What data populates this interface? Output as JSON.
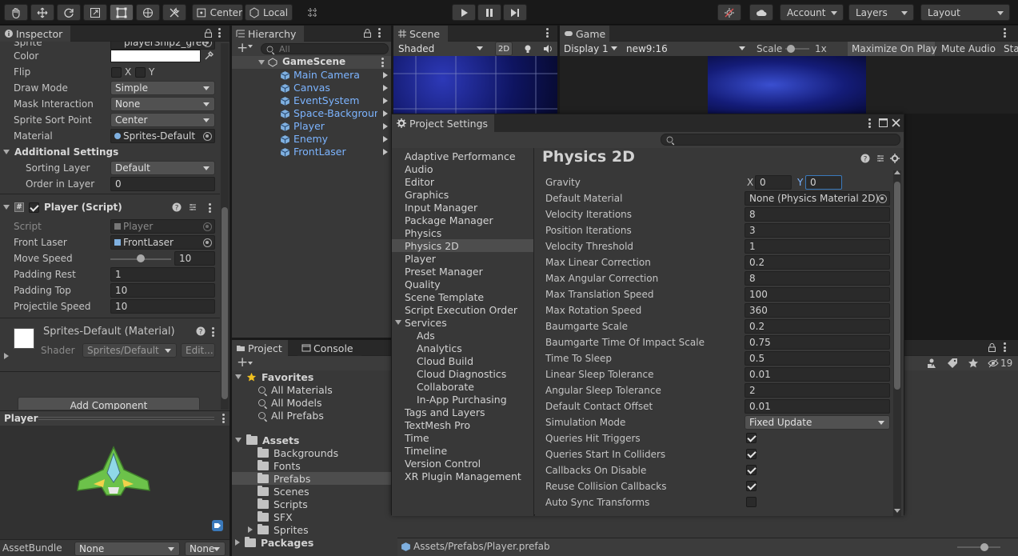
{
  "toolbar": {
    "pivot_label": "Center",
    "space_label": "Local",
    "account_label": "Account",
    "layers_label": "Layers",
    "layout_label": "Layout"
  },
  "inspector": {
    "tab_label": "Inspector",
    "sprite_label": "Sprite",
    "sprite_value": "playerShip2_gree",
    "color_label": "Color",
    "flip_label": "Flip",
    "flip_x": "X",
    "flip_y": "Y",
    "draw_mode_label": "Draw Mode",
    "draw_mode_value": "Simple",
    "mask_label": "Mask Interaction",
    "mask_value": "None",
    "sort_point_label": "Sprite Sort Point",
    "sort_point_value": "Center",
    "material_label": "Material",
    "material_value": "Sprites-Default",
    "additional_settings": "Additional Settings",
    "sorting_layer_label": "Sorting Layer",
    "sorting_layer_value": "Default",
    "order_label": "Order in Layer",
    "order_value": "0",
    "script_component": "Player (Script)",
    "script_label": "Script",
    "script_value": "Player",
    "front_laser_label": "Front Laser",
    "front_laser_value": "FrontLaser",
    "move_speed_label": "Move Speed",
    "move_speed_value": "10",
    "padding_rest_label": "Padding Rest",
    "padding_rest_value": "1",
    "padding_top_label": "Padding Top",
    "padding_top_value": "10",
    "projectile_speed_label": "Projectile Speed",
    "projectile_speed_value": "10",
    "material_header": "Sprites-Default (Material)",
    "shader_label": "Shader",
    "shader_value": "Sprites/Default",
    "edit_label": "Edit...",
    "add_component": "Add Component",
    "preview_title": "Player",
    "assetbundle_label": "AssetBundle",
    "assetbundle_value": "None",
    "assetbundle_variant": "None"
  },
  "hierarchy": {
    "tab_label": "Hierarchy",
    "search_placeholder": "All",
    "scene_name": "GameScene",
    "items": [
      "Main Camera",
      "Canvas",
      "EventSystem",
      "Space-Background",
      "Player",
      "Enemy",
      "FrontLaser"
    ]
  },
  "scene": {
    "tab_label": "Scene",
    "shading": "Shaded",
    "mode_2d": "2D"
  },
  "game": {
    "tab_label": "Game",
    "display": "Display 1",
    "aspect": "new9:16",
    "scale_label": "Scale",
    "scale_value": "1x",
    "maximize": "Maximize On Play",
    "mute": "Mute Audio",
    "stats": "Stats"
  },
  "project": {
    "tab_project": "Project",
    "tab_console": "Console",
    "favorites_label": "Favorites",
    "favorites": [
      "All Materials",
      "All Models",
      "All Prefabs"
    ],
    "assets_label": "Assets",
    "folders": [
      "Backgrounds",
      "Fonts",
      "Prefabs",
      "Scenes",
      "Scripts",
      "SFX",
      "Sprites"
    ],
    "packages_label": "Packages",
    "path": "Assets/Prefabs/Player.prefab",
    "hidden_count": "19"
  },
  "settings": {
    "window_title": "Project Settings",
    "categories": [
      "Adaptive Performance",
      "Audio",
      "Editor",
      "Graphics",
      "Input Manager",
      "Package Manager",
      "Physics",
      "Physics 2D",
      "Player",
      "Preset Manager",
      "Quality",
      "Scene Template",
      "Script Execution Order",
      "Services",
      "Ads",
      "Analytics",
      "Cloud Build",
      "Cloud Diagnostics",
      "Collaborate",
      "In-App Purchasing",
      "Tags and Layers",
      "TextMesh Pro",
      "Time",
      "Timeline",
      "Version Control",
      "XR Plugin Management"
    ],
    "selected": "Physics 2D",
    "page_title": "Physics 2D",
    "gravity_label": "Gravity",
    "gravity_x_label": "X",
    "gravity_x": "0",
    "gravity_y_label": "Y",
    "gravity_y": "0",
    "default_material_label": "Default Material",
    "default_material_value": "None (Physics Material 2D)",
    "props": [
      {
        "label": "Velocity Iterations",
        "value": "8"
      },
      {
        "label": "Position Iterations",
        "value": "3"
      },
      {
        "label": "Velocity Threshold",
        "value": "1"
      },
      {
        "label": "Max Linear Correction",
        "value": "0.2"
      },
      {
        "label": "Max Angular Correction",
        "value": "8"
      },
      {
        "label": "Max Translation Speed",
        "value": "100"
      },
      {
        "label": "Max Rotation Speed",
        "value": "360"
      },
      {
        "label": "Baumgarte Scale",
        "value": "0.2"
      },
      {
        "label": "Baumgarte Time Of Impact Scale",
        "value": "0.75"
      },
      {
        "label": "Time To Sleep",
        "value": "0.5"
      },
      {
        "label": "Linear Sleep Tolerance",
        "value": "0.01"
      },
      {
        "label": "Angular Sleep Tolerance",
        "value": "2"
      },
      {
        "label": "Default Contact Offset",
        "value": "0.01"
      }
    ],
    "sim_mode_label": "Simulation Mode",
    "sim_mode_value": "Fixed Update",
    "checks": [
      {
        "label": "Queries Hit Triggers",
        "checked": true
      },
      {
        "label": "Queries Start In Colliders",
        "checked": true
      },
      {
        "label": "Callbacks On Disable",
        "checked": true
      },
      {
        "label": "Reuse Collision Callbacks",
        "checked": true
      },
      {
        "label": "Auto Sync Transforms",
        "checked": false
      }
    ]
  },
  "colors": {
    "accent": "#3a79bb",
    "hierarchy_link": "#7cb4ff",
    "panel": "#383838",
    "background": "#191919"
  }
}
